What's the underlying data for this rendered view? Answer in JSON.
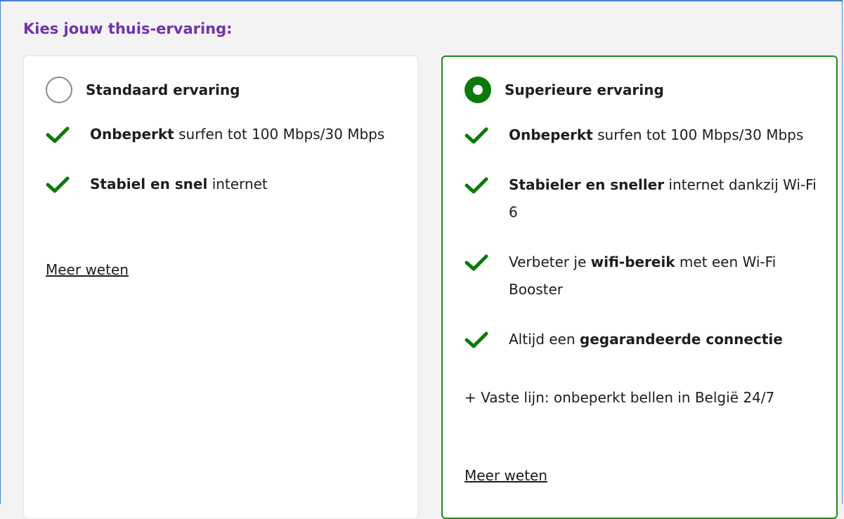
{
  "heading": "Kies jouw thuis-ervaring:",
  "options": [
    {
      "label": "Standaard ervaring",
      "selected": false,
      "features": [
        {
          "bold": "Onbeperkt",
          "after": " surfen tot 100 Mbps/30 Mbps"
        },
        {
          "bold": "Stabiel en snel",
          "after": " internet"
        }
      ],
      "more_link": "Meer weten"
    },
    {
      "label": "Superieure ervaring",
      "selected": true,
      "features": [
        {
          "bold": "Onbeperkt",
          "after": " surfen tot 100 Mbps/30 Mbps"
        },
        {
          "bold": "Stabieler en sneller",
          "after": " internet dankzij Wi-Fi 6"
        },
        {
          "before": "Verbeter je ",
          "bold": "wifi-bereik",
          "after": " met een Wi-Fi Booster"
        },
        {
          "before": "Altijd een ",
          "bold": "gegarandeerde connectie"
        }
      ],
      "extra": "+ Vaste lijn: onbeperkt bellen in België 24/7",
      "more_link": "Meer weten"
    }
  ],
  "colors": {
    "heading": "#7232a8",
    "check": "#0b7a0b",
    "selected_border": "#1e8a1e"
  },
  "icons": {
    "check": "check-icon",
    "radio": "radio-button-icon"
  }
}
